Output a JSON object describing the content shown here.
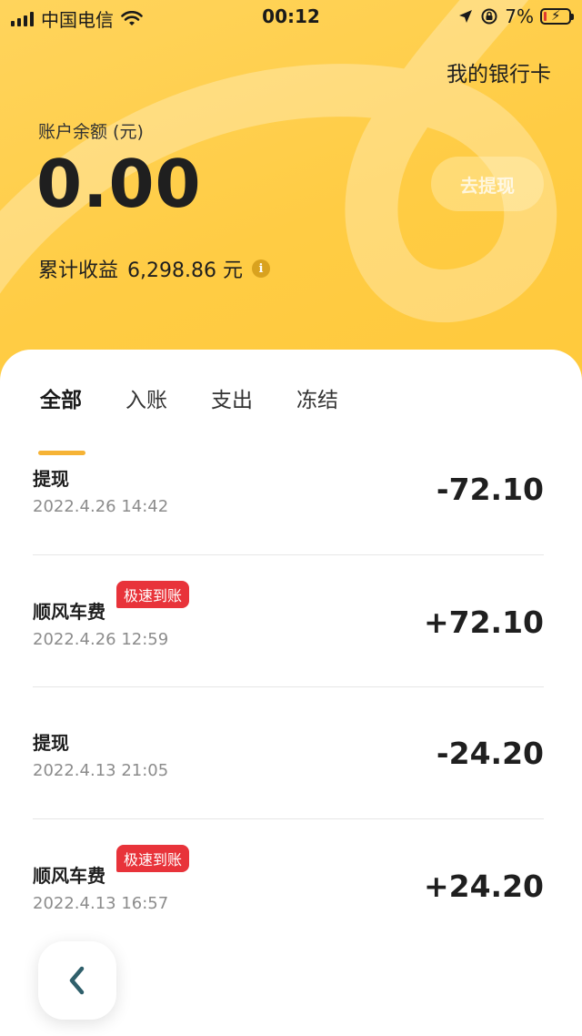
{
  "status_bar": {
    "carrier": "中国电信",
    "time": "00:12",
    "battery_percent": "7%",
    "battery_color": "#e03a2f"
  },
  "header": {
    "bank_card_link": "我的银行卡",
    "balance_label": "账户余额 (元)",
    "balance_value": "0.00",
    "withdraw_button": "去提现",
    "earnings_label": "累计收益",
    "earnings_value": "6,298.86 元",
    "info_icon": "i",
    "accent_color": "#ffcc44"
  },
  "tabs": [
    {
      "label": "全部",
      "active": true
    },
    {
      "label": "入账",
      "active": false
    },
    {
      "label": "支出",
      "active": false
    },
    {
      "label": "冻结",
      "active": false
    }
  ],
  "transactions": [
    {
      "name": "提现",
      "date": "2022.4.26 14:42",
      "amount": "-72.10",
      "badge": ""
    },
    {
      "name": "顺风车费",
      "date": "2022.4.26 12:59",
      "amount": "+72.10",
      "badge": "极速到账"
    },
    {
      "name": "提现",
      "date": "2022.4.13 21:05",
      "amount": "-24.20",
      "badge": ""
    },
    {
      "name": "顺风车费",
      "date": "2022.4.13 16:57",
      "amount": "+24.20",
      "badge": "极速到账"
    }
  ],
  "icons": {
    "back": "chevron-left-icon",
    "wifi": "wifi-icon",
    "location": "location-arrow-icon",
    "lock_rotation": "rotation-lock-icon",
    "battery": "battery-charging-icon"
  }
}
